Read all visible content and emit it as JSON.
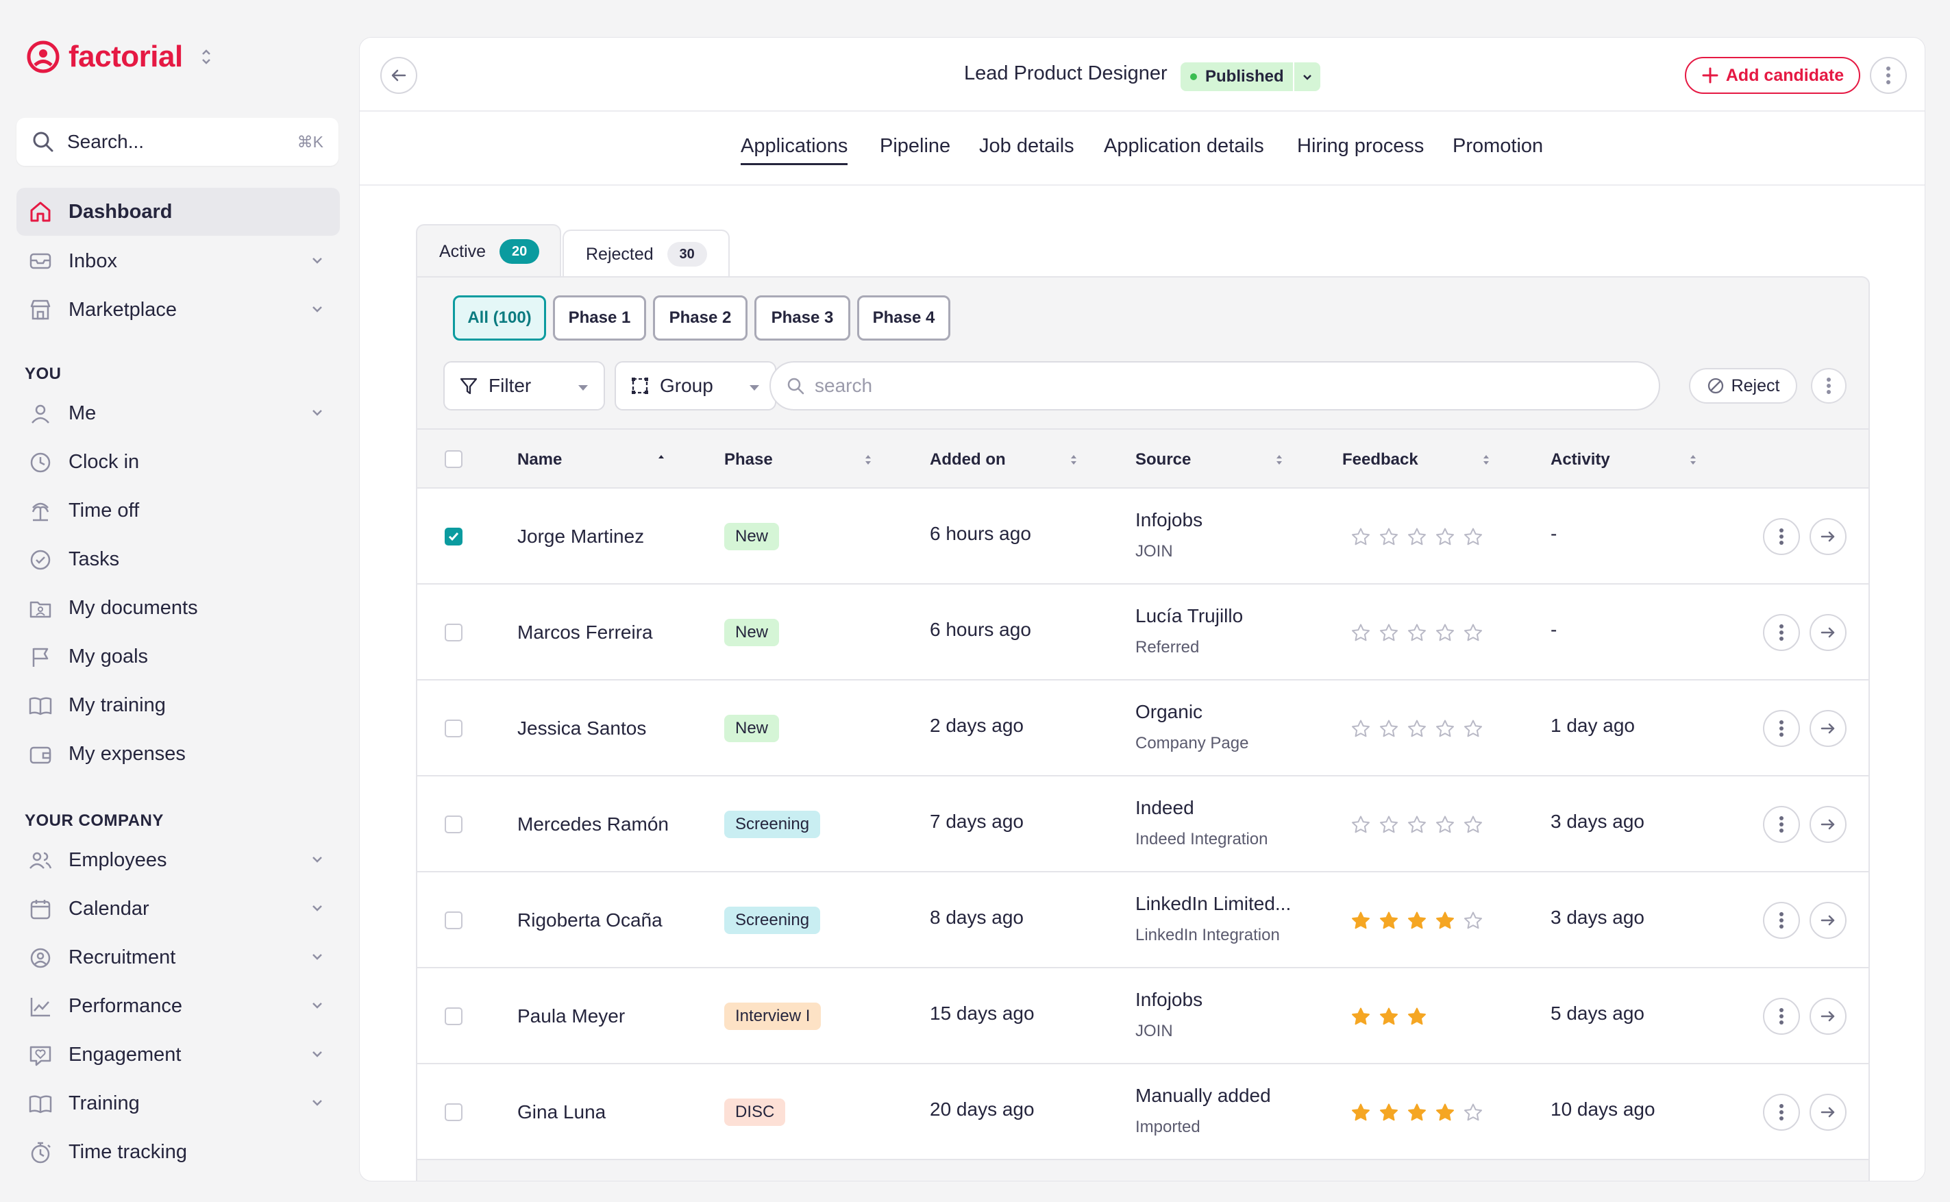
{
  "brand": {
    "name": "factorial",
    "accent": "#e51943"
  },
  "search": {
    "label": "Search...",
    "shortcut": "⌘K"
  },
  "nav": {
    "top": [
      {
        "label": "Dashboard",
        "icon": "home-icon",
        "active": true,
        "chevron": false
      },
      {
        "label": "Inbox",
        "icon": "inbox-icon",
        "chevron": true
      },
      {
        "label": "Marketplace",
        "icon": "store-icon",
        "chevron": true
      }
    ],
    "you_heading": "YOU",
    "you": [
      {
        "label": "Me",
        "icon": "user-icon",
        "chevron": true
      },
      {
        "label": "Clock in",
        "icon": "clock-icon"
      },
      {
        "label": "Time off",
        "icon": "palm-tree-icon"
      },
      {
        "label": "Tasks",
        "icon": "check-circle-icon"
      },
      {
        "label": "My documents",
        "icon": "folder-user-icon"
      },
      {
        "label": "My goals",
        "icon": "flag-icon"
      },
      {
        "label": "My training",
        "icon": "book-icon"
      },
      {
        "label": "My expenses",
        "icon": "wallet-icon"
      }
    ],
    "company_heading": "YOUR COMPANY",
    "company": [
      {
        "label": "Employees",
        "icon": "people-icon",
        "chevron": true
      },
      {
        "label": "Calendar",
        "icon": "calendar-icon",
        "chevron": true
      },
      {
        "label": "Recruitment",
        "icon": "user-search-icon",
        "chevron": true
      },
      {
        "label": "Performance",
        "icon": "chart-icon",
        "chevron": true
      },
      {
        "label": "Engagement",
        "icon": "heart-chat-icon",
        "chevron": true
      },
      {
        "label": "Training",
        "icon": "book-icon",
        "chevron": true
      },
      {
        "label": "Time tracking",
        "icon": "stopwatch-icon",
        "chevron": false
      }
    ]
  },
  "header": {
    "job_title": "Lead Product Designer",
    "status": "Published",
    "add_label": "Add candidate"
  },
  "tabs": [
    "Applications",
    "Pipeline",
    "Job details",
    "Application details",
    "Hiring process",
    "Promotion"
  ],
  "subtabs": [
    {
      "label": "Active",
      "count": "20"
    },
    {
      "label": "Rejected",
      "count": "30"
    }
  ],
  "phases": [
    "All (100)",
    "Phase 1",
    "Phase 2",
    "Phase 3",
    "Phase 4"
  ],
  "toolbar": {
    "filter": "Filter",
    "group": "Group",
    "search_placeholder": "search",
    "reject": "Reject"
  },
  "columns": [
    "Name",
    "Phase",
    "Added on",
    "Source",
    "Feedback",
    "Activity"
  ],
  "rows": [
    {
      "name": "Jorge Martinez",
      "phase": "New",
      "tag": "new",
      "added": "6 hours ago",
      "source": "Infojobs",
      "source_sub": "JOIN",
      "rating": 0,
      "activity": "-",
      "checked": true
    },
    {
      "name": "Marcos Ferreira",
      "phase": "New",
      "tag": "new",
      "added": "6 hours ago",
      "source": "Lucía Trujillo",
      "source_sub": "Referred",
      "rating": 0,
      "activity": "-",
      "checked": false
    },
    {
      "name": "Jessica Santos",
      "phase": "New",
      "tag": "new",
      "added": "2 days ago",
      "source": "Organic",
      "source_sub": "Company Page",
      "rating": 0,
      "activity": "1 day ago",
      "checked": false
    },
    {
      "name": "Mercedes Ramón",
      "phase": "Screening",
      "tag": "screening",
      "added": "7 days ago",
      "source": "Indeed",
      "source_sub": "Indeed Integration",
      "rating": 0,
      "activity": "3 days ago",
      "checked": false
    },
    {
      "name": "Rigoberta Ocaña",
      "phase": "Screening",
      "tag": "screening",
      "added": "8 days ago",
      "source": "LinkedIn Limited...",
      "source_sub": "LinkedIn Integration",
      "rating": 4,
      "activity": "3 days ago",
      "checked": false
    },
    {
      "name": "Paula Meyer",
      "phase": "Interview I",
      "tag": "interview",
      "added": "15 days ago",
      "source": "Infojobs",
      "source_sub": "JOIN",
      "rating": 3,
      "max": 3,
      "activity": "5 days ago",
      "checked": false
    },
    {
      "name": "Gina Luna",
      "phase": "DISC",
      "tag": "disc",
      "added": "20 days ago",
      "source": "Manually added",
      "source_sub": "Imported",
      "rating": 4,
      "activity": "10 days ago",
      "checked": false
    }
  ],
  "colors": {
    "teal": "#0b9b9f",
    "star": "#f5a623",
    "published": "#3bbd51"
  }
}
